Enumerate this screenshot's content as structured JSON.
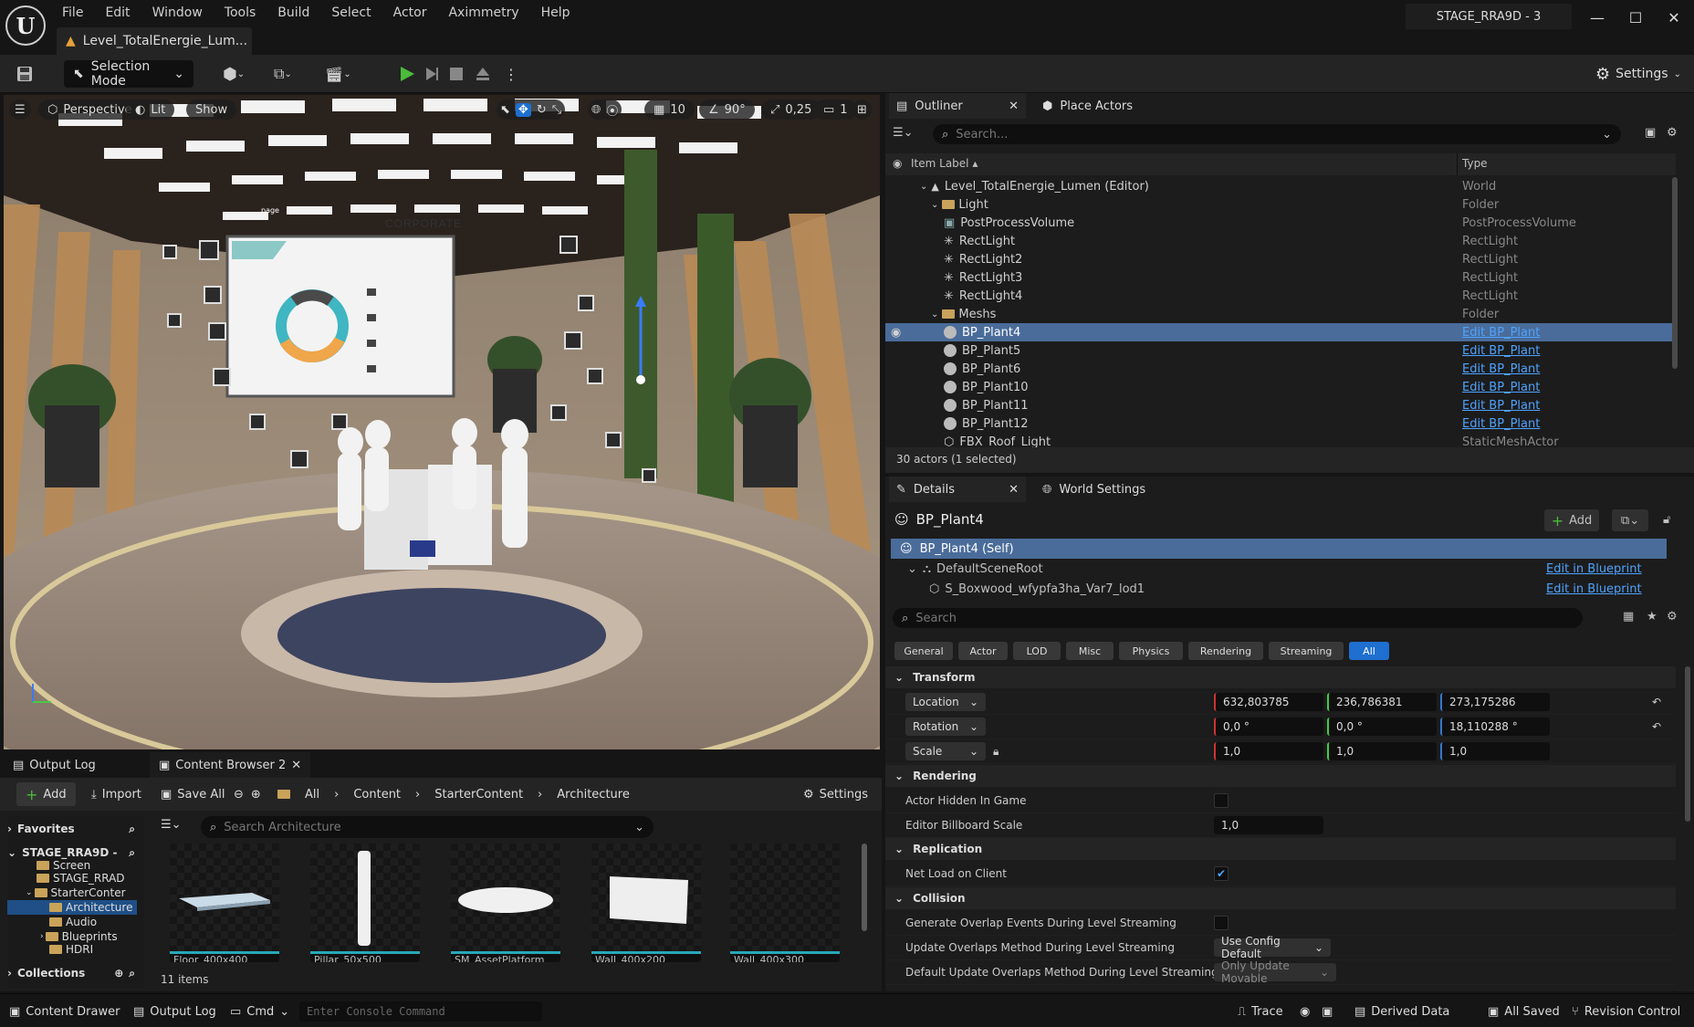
{
  "menu": [
    "File",
    "Edit",
    "Window",
    "Tools",
    "Build",
    "Select",
    "Actor",
    "Aximmetry",
    "Help"
  ],
  "document_tab": "Level_TotalEnergie_Lum...",
  "project_name": "STAGE_RRA9D - 3",
  "toolbar": {
    "selection_mode": "Selection Mode",
    "settings": "Settings"
  },
  "viewport": {
    "perspective": "Perspective",
    "lit": "Lit",
    "show": "Show",
    "grid_snap": "10",
    "rotation_snap": "90°",
    "scale_snap": "0,25",
    "camera_speed": "1",
    "screen_text_corporate": "CORPORATE",
    "screen_text_page": "page"
  },
  "drawer": {
    "tab_output_log": "Output Log",
    "tab_content_browser": "Content Browser 2",
    "add": "Add",
    "import": "Import",
    "save_all": "Save All",
    "breadcrumb": [
      "All",
      "Content",
      "StarterContent",
      "Architecture"
    ],
    "settings": "Settings",
    "favorites": "Favorites",
    "tree_root": "STAGE_RRA9D -",
    "tree": [
      "Screen",
      "STAGE_RRAD",
      "StarterConter",
      "Architecture",
      "Audio",
      "Blueprints",
      "HDRI"
    ],
    "collections": "Collections",
    "search_placeholder": "Search Architecture",
    "assets": [
      "Floor_400x400",
      "Pillar_50x500",
      "SM_AssetPlatform",
      "Wall_400x200",
      "Wall_400x300"
    ],
    "item_count": "11 items"
  },
  "statusbar": {
    "content_drawer": "Content Drawer",
    "output_log": "Output Log",
    "cmd": "Cmd",
    "console_placeholder": "Enter Console Command",
    "trace": "Trace",
    "derived_data": "Derived Data",
    "all_saved": "All Saved",
    "revision_control": "Revision Control"
  },
  "outliner": {
    "tab": "Outliner",
    "tab2": "Place Actors",
    "search_placeholder": "Search...",
    "col_label": "Item Label",
    "col_type": "Type",
    "rows": [
      {
        "label": "Level_TotalEnergie_Lumen (Editor)",
        "type": "World"
      },
      {
        "label": "Light",
        "type": "Folder"
      },
      {
        "label": "PostProcessVolume",
        "type": "PostProcessVolume"
      },
      {
        "label": "RectLight",
        "type": "RectLight"
      },
      {
        "label": "RectLight2",
        "type": "RectLight"
      },
      {
        "label": "RectLight3",
        "type": "RectLight"
      },
      {
        "label": "RectLight4",
        "type": "RectLight"
      },
      {
        "label": "Meshs",
        "type": "Folder"
      },
      {
        "label": "BP_Plant4",
        "type": "Edit BP_Plant"
      },
      {
        "label": "BP_Plant5",
        "type": "Edit BP_Plant"
      },
      {
        "label": "BP_Plant6",
        "type": "Edit BP_Plant"
      },
      {
        "label": "BP_Plant10",
        "type": "Edit BP_Plant"
      },
      {
        "label": "BP_Plant11",
        "type": "Edit BP_Plant"
      },
      {
        "label": "BP_Plant12",
        "type": "Edit BP_Plant"
      },
      {
        "label": "FBX_Roof_Light",
        "type": "StaticMeshActor"
      }
    ],
    "footer": "30 actors (1 selected)"
  },
  "details": {
    "tab": "Details",
    "tab2": "World Settings",
    "actor_name": "BP_Plant4",
    "add": "Add",
    "self": "BP_Plant4 (Self)",
    "root": "DefaultSceneRoot",
    "component": "S_Boxwood_wfypfa3ha_Var7_lod1",
    "edit_in_blueprint": "Edit in Blueprint",
    "search_placeholder": "Search",
    "filters": [
      "General",
      "Actor",
      "LOD",
      "Misc",
      "Physics",
      "Rendering",
      "Streaming",
      "All"
    ],
    "transform": "Transform",
    "location": "Location",
    "rotation": "Rotation",
    "scale": "Scale",
    "loc": [
      "632,803785",
      "236,786381",
      "273,175286"
    ],
    "rot": [
      "0,0 °",
      "0,0 °",
      "18,110288 °"
    ],
    "scl": [
      "1,0",
      "1,0",
      "1,0"
    ],
    "rendering": "Rendering",
    "actor_hidden": "Actor Hidden In Game",
    "billboard": "Editor Billboard Scale",
    "billboard_val": "1,0",
    "replication": "Replication",
    "net_load": "Net Load on Client",
    "collision": "Collision",
    "gen_overlap": "Generate Overlap Events During Level Streaming",
    "update_overlap": "Update Overlaps Method During Level Streaming",
    "update_overlap_val": "Use Config Default",
    "default_update_overlap": "Default Update Overlaps Method During Level Streaming",
    "default_update_overlap_val": "Only Update Movable"
  }
}
